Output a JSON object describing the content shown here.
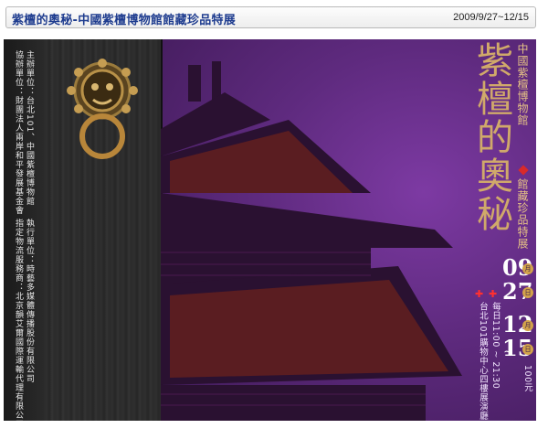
{
  "header": {
    "title": "紫檀的奧秘-中國紫檀博物館館藏珍品特展",
    "date_range": "2009/9/27~12/15"
  },
  "banner": {
    "sponsors": {
      "col1": "主辦單位：台北101、中國紫檀博物館",
      "col2": "協辦單位：財團法人兩岸和平發展基金會",
      "col3": "執行單位：時藝多媒體傳播股份有限公司",
      "col4": "指定物流服務商：北京韻艾爾國際運輸代理有限公司"
    },
    "main_title": "紫檀的奧秘",
    "subtitle_1": "中國紫檀博物館",
    "subtitle_2": "館藏珍品特展",
    "dates": {
      "start_month": "09",
      "start_day": "27",
      "tilde": "~",
      "end_month": "12",
      "end_day": "15",
      "month_char": "月",
      "day_char": "日"
    },
    "hours": "每日11:00 ~ 21:30",
    "venue": "台北101購物中心四樓展演廳",
    "price": "100元",
    "accent_colors": {
      "purple": "#5e2a7e",
      "gold": "#d0a96a",
      "red": "#d92a2a"
    }
  }
}
